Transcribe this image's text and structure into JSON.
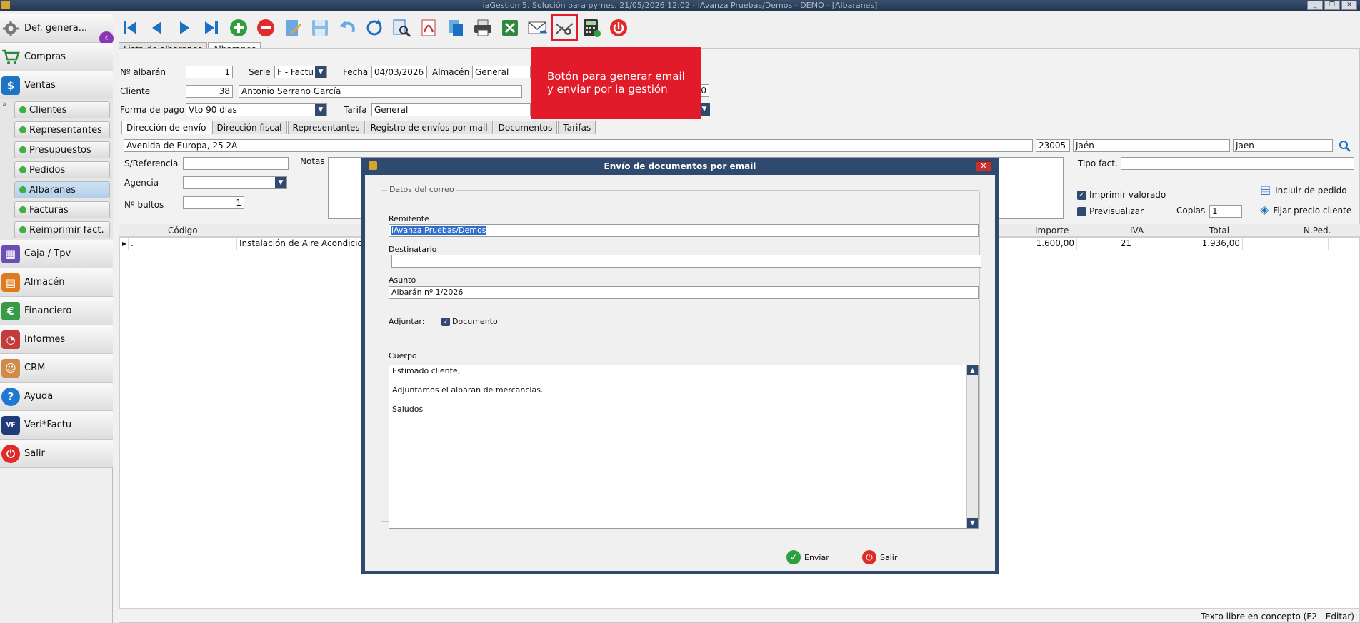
{
  "window": {
    "title": "iaGestion 5. Solución para pymes.   21/05/2026 12:02   - iAvanza Pruebas/Demos - DEMO - [Albaranes]",
    "buttons": [
      "_",
      "❐",
      "✕"
    ]
  },
  "sidebar": {
    "items": [
      {
        "label": "Def. genera...",
        "icon": "gear-icon",
        "color": "#666666"
      },
      {
        "label": "Compras",
        "icon": "cart-icon",
        "color": "#2b8a3e"
      },
      {
        "label": "Ventas",
        "icon": "sales-icon",
        "color": "#1d74c4"
      },
      {
        "label": "Caja / Tpv",
        "icon": "cash-register-icon",
        "color": "#6b4fb5"
      },
      {
        "label": "Almacén",
        "icon": "warehouse-icon",
        "color": "#e07a1f"
      },
      {
        "label": "Financiero",
        "icon": "money-icon",
        "color": "#3a9b47"
      },
      {
        "label": "Informes",
        "icon": "report-icon",
        "color": "#c43b3b"
      },
      {
        "label": "CRM",
        "icon": "person-icon",
        "color": "#d08a4a"
      },
      {
        "label": "Ayuda",
        "icon": "help-icon",
        "color": "#1f78d1"
      },
      {
        "label": "Veri*Factu",
        "icon": "verifactu-icon",
        "color": "#1f3c78"
      },
      {
        "label": "Salir",
        "icon": "power-icon",
        "color": "#e02b2b"
      }
    ],
    "sub_items": [
      {
        "label": "Clientes"
      },
      {
        "label": "Representantes"
      },
      {
        "label": "Presupuestos"
      },
      {
        "label": "Pedidos"
      },
      {
        "label": "Albaranes",
        "active": true
      },
      {
        "label": "Facturas"
      },
      {
        "label": "Reimprimir fact."
      }
    ]
  },
  "toolbar": {
    "buttons": [
      "first",
      "previous",
      "next",
      "last",
      "add",
      "delete",
      "edit",
      "save",
      "undo",
      "refresh",
      "search",
      "pdf",
      "copy",
      "print",
      "excel",
      "email",
      "email-send",
      "calculator",
      "power"
    ]
  },
  "main_tabs": [
    {
      "label": "Lista de albaranes"
    },
    {
      "label": "Albaranes",
      "active": true
    }
  ],
  "form": {
    "numero_label": "Nº albarán",
    "numero_value": "1",
    "serie_label": "Serie",
    "serie_value": "F  - Factu",
    "fecha_label": "Fecha",
    "fecha_value": "04/03/2026",
    "almacen_label": "Almacén",
    "almacen_value": "General",
    "extra_value": "0",
    "cliente_label": "Cliente",
    "cliente_code": "38",
    "cliente_name": "Antonio Serrano García",
    "forma_pago_label": "Forma de pago",
    "forma_pago_value": "Vto 90 días",
    "tarifa_label": "Tarifa",
    "tarifa_value": "General"
  },
  "sub_tabs": [
    {
      "label": "Dirección de envío",
      "active": true
    },
    {
      "label": "Dirección fiscal"
    },
    {
      "label": "Representantes"
    },
    {
      "label": "Registro de envíos por mail"
    },
    {
      "label": "Documentos"
    },
    {
      "label": "Tarifas"
    }
  ],
  "address": {
    "street": "Avenida de Europa, 25 2A",
    "postal": "23005",
    "city": "Jaén",
    "province": "Jaen"
  },
  "details": {
    "referencia_label": "S/Referencia",
    "notas_label": "Notas",
    "agencia_label": "Agencia",
    "bultos_label": "Nº bultos",
    "bultos_value": "1",
    "tipo_fact_label": "Tipo fact.",
    "imprimir_valorado_label": "Imprimir valorado",
    "previsualizar_label": "Previsualizar",
    "copias_label": "Copias",
    "copias_value": "1",
    "incluir_pedido_label": "Incluir de pedido",
    "fijar_precio_label": "Fijar precio cliente"
  },
  "grid": {
    "columns": [
      "Código",
      "Importe",
      "IVA",
      "Total",
      "N.Ped."
    ],
    "rows": [
      {
        "codigo": ".",
        "descripcion": "Instalación de Aire Acondicion",
        "importe": "1.600,00",
        "iva": "21",
        "total": "1.936,00",
        "nped": ""
      }
    ]
  },
  "status_bar": {
    "text": "Texto libre en concepto (F2 - Editar)"
  },
  "callout": {
    "text": "Botón para generar email y enviar por ia gestión"
  },
  "modal": {
    "title": "Envío de documentos por email",
    "group_title": "Datos del correo",
    "remitente_label": "Remitente",
    "remitente_value": "iAvanza Pruebas/Demos",
    "destinatario_label": "Destinatario",
    "destinatario_value": "",
    "asunto_label": "Asunto",
    "asunto_value": "Albarán nº 1/2026",
    "adjuntar_label": "Adjuntar:",
    "documento_label": "Documento",
    "cuerpo_label": "Cuerpo",
    "cuerpo_lines": [
      "Estimado cliente,",
      "Adjuntamos el albaran de mercancias.",
      "Saludos"
    ],
    "enviar_label": "Enviar",
    "salir_label": "Salir"
  }
}
